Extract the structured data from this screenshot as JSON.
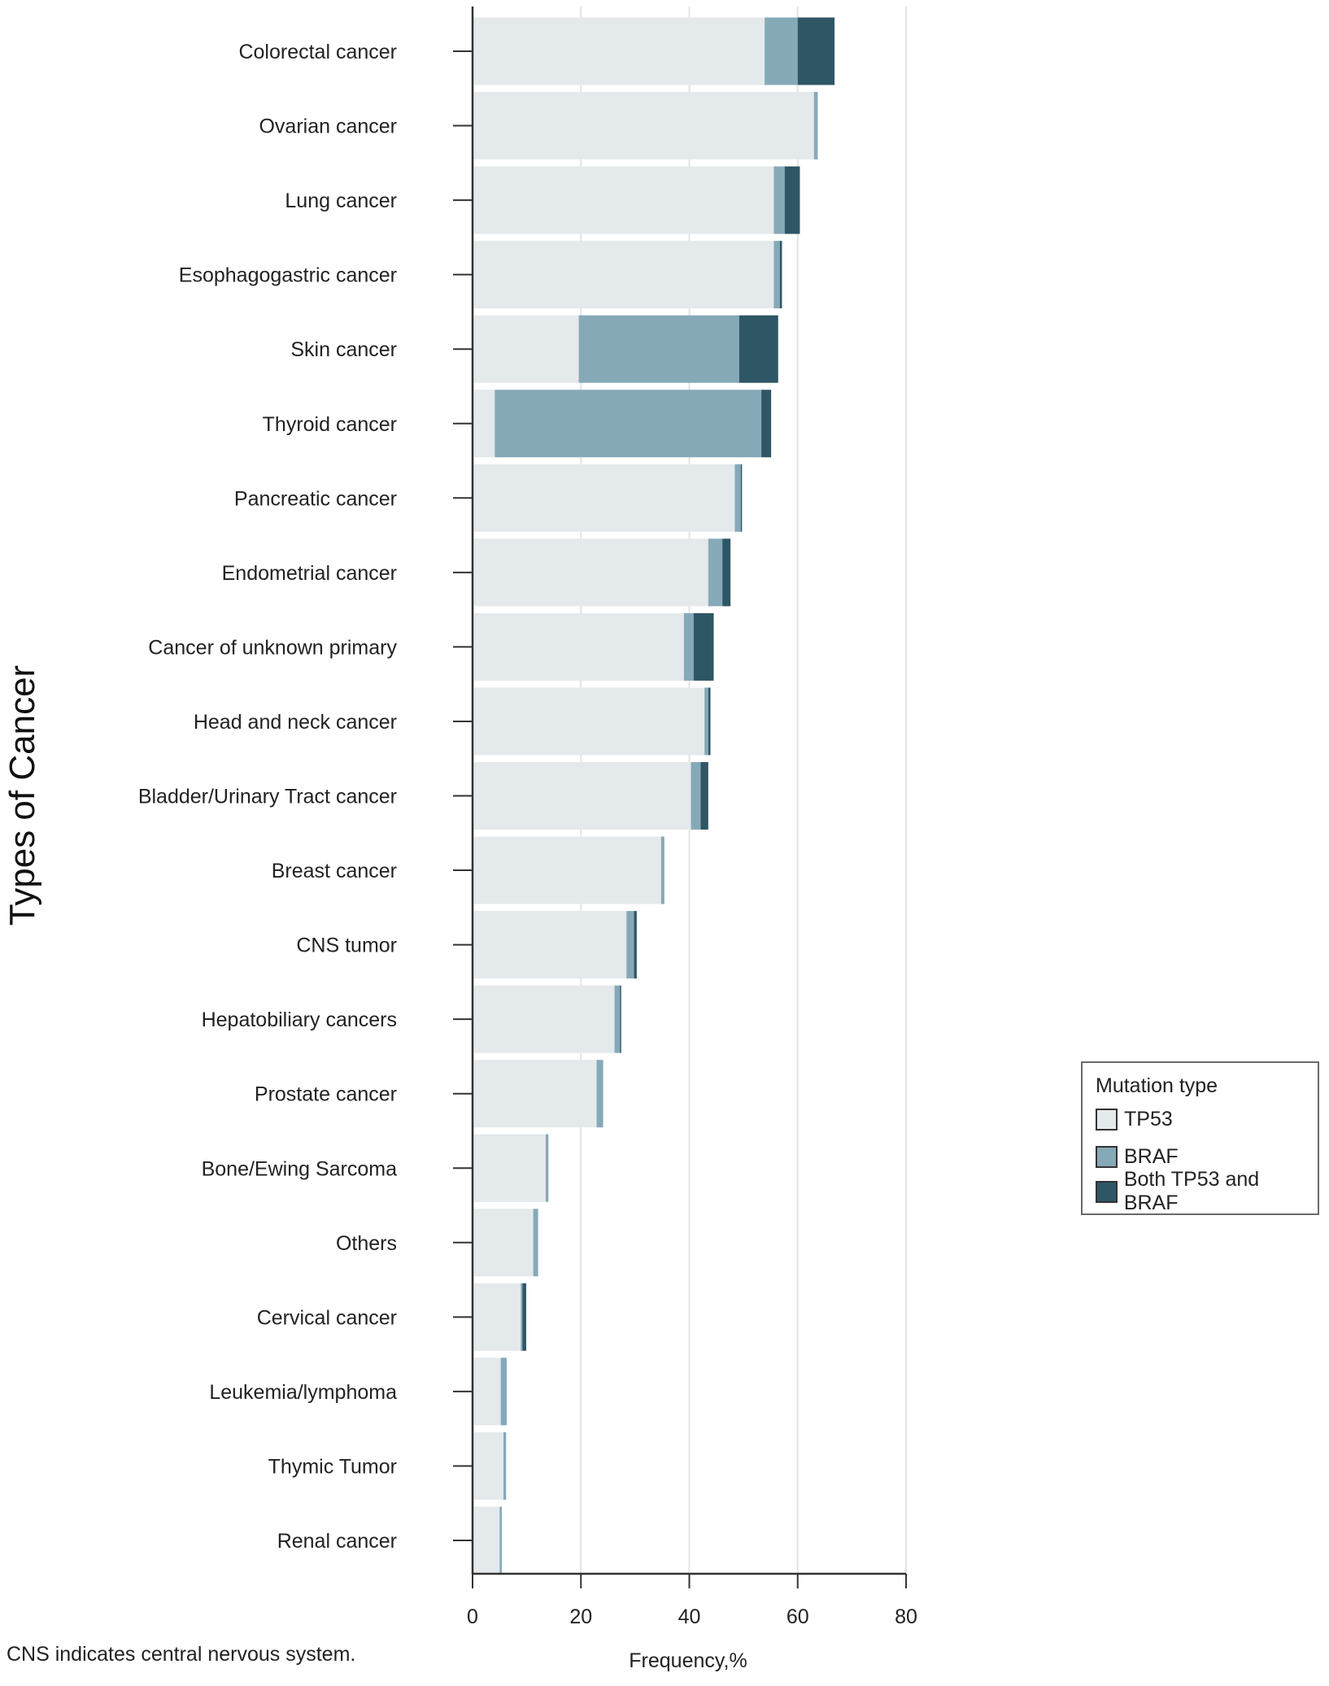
{
  "chart_data": {
    "type": "bar",
    "orientation": "horizontal",
    "stacked": true,
    "title": "",
    "xlabel": "Frequency,%",
    "ylabel": "Types of Cancer",
    "xlim": [
      0,
      80
    ],
    "xticks": [
      0,
      20,
      40,
      60,
      80
    ],
    "grid": "vertical",
    "legend_position": "right",
    "legend_title": "Mutation type",
    "categories": [
      "Colorectal cancer",
      "Ovarian cancer",
      "Lung cancer",
      "Esophagogastric cancer",
      "Skin cancer",
      "Thyroid cancer",
      "Pancreatic cancer",
      "Endometrial cancer",
      "Cancer of unknown primary",
      "Head and neck cancer",
      "Bladder/Urinary Tract cancer",
      "Breast cancer",
      "CNS tumor",
      "Hepatobiliary cancers",
      "Prostate cancer",
      "Bone/Ewing Sarcoma",
      "Others",
      "Cervical cancer",
      "Leukemia/lymphoma",
      "Thymic Tumor",
      "Renal cancer"
    ],
    "series": [
      {
        "name": "TP53",
        "color": "#e4e9ec",
        "values": [
          53.9,
          63.0,
          55.6,
          55.6,
          19.6,
          4.1,
          48.4,
          43.5,
          39.0,
          42.8,
          40.3,
          34.8,
          28.4,
          26.2,
          22.9,
          13.5,
          11.2,
          8.9,
          5.2,
          5.7,
          5.0
        ]
      },
      {
        "name": "BRAF",
        "color": "#86a9b8",
        "values": [
          6.1,
          0.7,
          2.0,
          1.1,
          29.6,
          49.2,
          1.1,
          2.6,
          1.8,
          0.7,
          1.8,
          0.6,
          1.4,
          1.0,
          1.2,
          0.5,
          0.9,
          0.3,
          1.1,
          0.5,
          0.4
        ]
      },
      {
        "name": "Both TP53 and BRAF",
        "color": "#2f5664",
        "values": [
          6.8,
          0.0,
          2.8,
          0.4,
          7.2,
          1.8,
          0.2,
          1.5,
          3.7,
          0.4,
          1.4,
          0.0,
          0.5,
          0.2,
          0.0,
          0.0,
          0.0,
          0.7,
          0.0,
          0.0,
          0.0
        ]
      }
    ]
  },
  "footnote": "CNS indicates central nervous system."
}
